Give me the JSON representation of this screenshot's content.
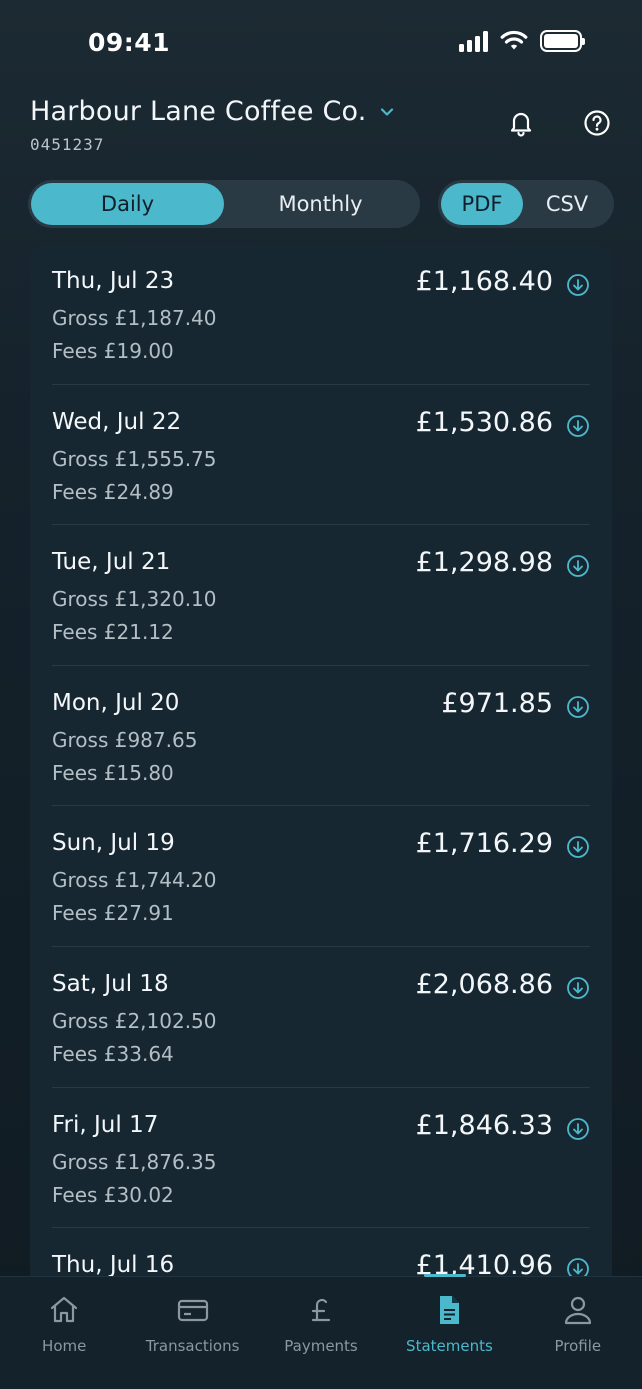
{
  "status_bar": {
    "time": "09:41"
  },
  "header": {
    "merchant_name": "Harbour Lane Coffee Co.",
    "merchant_id": "0451237"
  },
  "period_toggle": {
    "options": [
      "Daily",
      "Monthly"
    ],
    "selected": "Daily"
  },
  "format_toggle": {
    "options": [
      "PDF",
      "CSV"
    ],
    "selected": "PDF"
  },
  "statements": [
    {
      "date": "Thu, Jul 23",
      "gross": "Gross £1,187.40",
      "fees": "Fees £19.00",
      "net": "£1,168.40"
    },
    {
      "date": "Wed, Jul 22",
      "gross": "Gross £1,555.75",
      "fees": "Fees £24.89",
      "net": "£1,530.86"
    },
    {
      "date": "Tue, Jul 21",
      "gross": "Gross £1,320.10",
      "fees": "Fees £21.12",
      "net": "£1,298.98"
    },
    {
      "date": "Mon, Jul 20",
      "gross": "Gross £987.65",
      "fees": "Fees £15.80",
      "net": "£971.85"
    },
    {
      "date": "Sun, Jul 19",
      "gross": "Gross £1,744.20",
      "fees": "Fees £27.91",
      "net": "£1,716.29"
    },
    {
      "date": "Sat, Jul 18",
      "gross": "Gross £2,102.50",
      "fees": "Fees £33.64",
      "net": "£2,068.86"
    },
    {
      "date": "Fri, Jul 17",
      "gross": "Gross £1,876.35",
      "fees": "Fees £30.02",
      "net": "£1,846.33"
    },
    {
      "date": "Thu, Jul 16",
      "gross": "",
      "fees": "",
      "net": "£1,410.96"
    }
  ],
  "tab_bar": {
    "tabs": [
      {
        "label": "Home",
        "icon": "home-icon"
      },
      {
        "label": "Transactions",
        "icon": "card-icon"
      },
      {
        "label": "Payments",
        "icon": "pound-icon"
      },
      {
        "label": "Statements",
        "icon": "document-icon"
      },
      {
        "label": "Profile",
        "icon": "user-icon"
      }
    ],
    "active": "Statements"
  },
  "colors": {
    "accent": "#4bb8cc",
    "background": "#15222b",
    "panel": "#172731"
  }
}
